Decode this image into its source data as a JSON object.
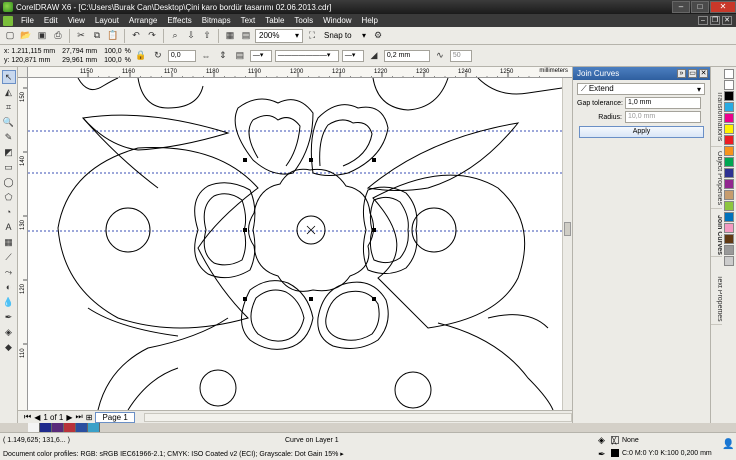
{
  "window": {
    "title": "CorelDRAW X6 - [C:\\Users\\Burak Can\\Desktop\\Çini karo bordür tasarımı 02.06.2013.cdr]",
    "min": "–",
    "max": "□",
    "close": "✕"
  },
  "menu": [
    "File",
    "Edit",
    "View",
    "Layout",
    "Arrange",
    "Effects",
    "Bitmaps",
    "Text",
    "Table",
    "Tools",
    "Window",
    "Help"
  ],
  "toolbar": {
    "zoom": "200%",
    "snap": "Snap to"
  },
  "property_bar": {
    "x": "x:  1.211,115 mm",
    "y": "y:  120,871 mm",
    "w": "27,794 mm",
    "h": "29,961 mm",
    "scale_x": "100,0",
    "scale_y": "100,0",
    "pct": "%",
    "rotation": "0,0",
    "outline": "0,2 mm",
    "smooth": "50"
  },
  "rulers": {
    "h_ticks": [
      "1150",
      "1160",
      "1170",
      "1180",
      "1190",
      "1200",
      "1210",
      "1220",
      "1230",
      "1240",
      "1250",
      "1260"
    ],
    "unit": "millimeters",
    "v_ticks": [
      "150",
      "140",
      "130",
      "120",
      "110"
    ]
  },
  "docker": {
    "title": "Join Curves",
    "mode": "Extend",
    "gap_label": "Gap tolerance:",
    "gap_value": "1,0 mm",
    "radius_label": "Radius:",
    "radius_value": "10,0 mm",
    "apply": "Apply"
  },
  "side_tabs": [
    "Transformations",
    "Object Properties",
    "Join Curves",
    "Text Properties"
  ],
  "page_bar": {
    "current": "1 of 1",
    "page_tab": "Page 1"
  },
  "status": {
    "cursor": "( 1.149,625; 131,6... )",
    "object": "Curve on Layer 1",
    "fill": "None",
    "outline": "C:0 M:0 Y:0 K:100  0,200 mm",
    "profiles": "Document color profiles: RGB: sRGB IEC61966-2.1; CMYK: ISO Coated v2 (ECI); Grayscale: Dot Gain 15% ▸"
  },
  "colors": {
    "accent": "#2f5f9f",
    "guide": "#3a4fb5",
    "palette": [
      "#1f2a8c",
      "#5a2a7a",
      "#b8323a",
      "#2b4fa0",
      "#3aa0c8"
    ]
  }
}
